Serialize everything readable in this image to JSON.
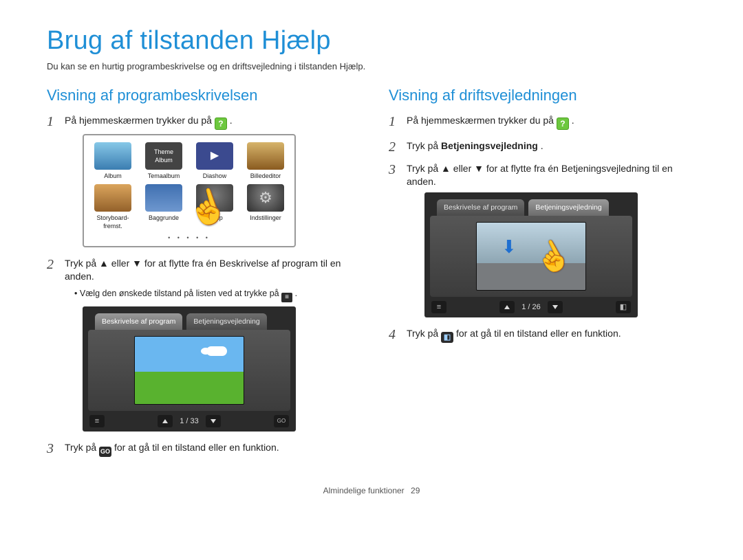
{
  "title": "Brug af tilstanden Hjælp",
  "intro": "Du kan se en hurtig programbeskrivelse og en driftsvejledning i tilstanden Hjælp.",
  "left": {
    "heading": "Visning af programbeskrivelsen",
    "step1_a": "På hjemmeskærmen trykker du på ",
    "step1_b": ".",
    "menu": {
      "items": [
        {
          "label": "Album"
        },
        {
          "label": "Temaalbum"
        },
        {
          "label": "Diashow"
        },
        {
          "label": "Billededitor"
        },
        {
          "label": "Storyboard-fremst."
        },
        {
          "label": "Baggrunde"
        },
        {
          "label": "Hjælp"
        },
        {
          "label": "Indstillinger"
        }
      ]
    },
    "step2": "Tryk på ▲ eller ▼ for at flytte fra én Beskrivelse af program til en anden.",
    "step2_sub_a": "Vælg den ønskede tilstand på listen ved at trykke på ",
    "step2_sub_b": ".",
    "screen1": {
      "tab_active": "Beskrivelse af program",
      "tab_other": "Betjeningsvejledning",
      "counter": "1 / 33"
    },
    "step3_a": "Tryk på ",
    "step3_go": "GO",
    "step3_b": " for at gå til en tilstand eller en funktion."
  },
  "right": {
    "heading": "Visning af driftsvejledningen",
    "step1_a": "På hjemmeskærmen trykker du på ",
    "step1_b": ".",
    "step2_a": "Tryk på ",
    "step2_bold": "Betjeningsvejledning",
    "step2_b": ".",
    "step3": "Tryk på ▲ eller ▼ for at flytte fra én Betjeningsvejledning til en anden.",
    "screen2": {
      "tab_other": "Beskrivelse af program",
      "tab_active": "Betjeningsvejledning",
      "counter": "1 / 26"
    },
    "step4_a": "Tryk på ",
    "step4_b": " for at gå til en tilstand eller en funktion."
  },
  "icons": {
    "help_glyph": "?",
    "list_glyph": "≡",
    "go_glyph": "GO",
    "cam_glyph": "◧"
  },
  "footer": {
    "section": "Almindelige funktioner",
    "page": "29"
  }
}
